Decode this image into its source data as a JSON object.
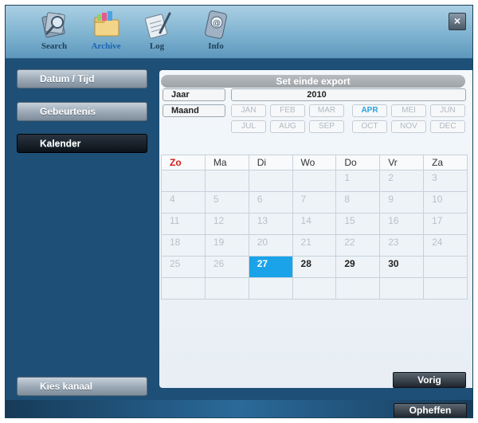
{
  "toolbar": {
    "items": [
      {
        "label": "Search",
        "icon": "search-icon"
      },
      {
        "label": "Archive",
        "icon": "archive-folder-icon",
        "active": true
      },
      {
        "label": "Log",
        "icon": "log-notepad-icon"
      },
      {
        "label": "Info",
        "icon": "info-device-icon"
      }
    ],
    "close_label": "×"
  },
  "sidebar": {
    "items": [
      {
        "label": "Datum / Tijd"
      },
      {
        "label": "Gebeurtenis"
      },
      {
        "label": "Kalender",
        "active": true
      }
    ],
    "channel_label": "Kies kanaal"
  },
  "panel": {
    "title": "Set einde export",
    "year_label": "Jaar",
    "year_value": "2010",
    "month_label": "Maand",
    "months": [
      "JAN",
      "FEB",
      "MAR",
      "APR",
      "MEI",
      "JUN",
      "JUL",
      "AUG",
      "SEP",
      "OCT",
      "NOV",
      "DEC"
    ],
    "selected_month": "APR",
    "weekdays": [
      "Zo",
      "Ma",
      "Di",
      "Wo",
      "Do",
      "Vr",
      "Za"
    ],
    "weeks": [
      [
        "",
        "",
        "",
        "",
        "1",
        "2",
        "3"
      ],
      [
        "4",
        "5",
        "6",
        "7",
        "8",
        "9",
        "10"
      ],
      [
        "11",
        "12",
        "13",
        "14",
        "15",
        "16",
        "17"
      ],
      [
        "18",
        "19",
        "20",
        "21",
        "22",
        "23",
        "24"
      ],
      [
        "25",
        "26",
        "27",
        "28",
        "29",
        "30",
        ""
      ],
      [
        "",
        "",
        "",
        "",
        "",
        "",
        ""
      ]
    ],
    "selected_day": "27",
    "prev_label": "Vorig"
  },
  "footer": {
    "cancel_label": "Opheffen"
  },
  "colors": {
    "accent": "#1aa3e8",
    "sunday": "#d31c1c",
    "window_bg": "#1e4f76"
  }
}
